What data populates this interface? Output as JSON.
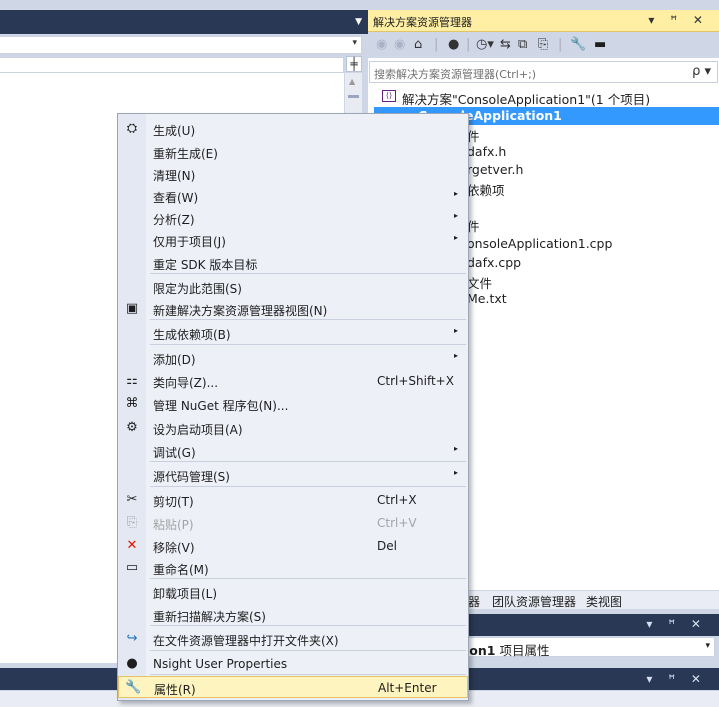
{
  "solution_explorer": {
    "title": "解决方案资源管理器",
    "window_controls": "▾ ꟸ ✕",
    "search_placeholder": "搜索解决方案资源管理器(Ctrl+;)",
    "search_icon": "ρ ▾",
    "toolbar_icons": [
      "back-icon",
      "forward-icon",
      "home-icon",
      "sync-icon",
      "history-icon",
      "collapse-icon",
      "show-all-icon",
      "properties-icon",
      "wrench-icon",
      "pin-icon"
    ],
    "tree": {
      "solution": "解决方案\"ConsoleApplication1\"(1 个项目)",
      "project": "ConsoleApplication1",
      "items": [
        "件",
        "dafx.h",
        "rgetver.h",
        "依赖项",
        "件",
        "onsoleApplication1.cpp",
        "dafx.cpp",
        "文件",
        "Me.txt"
      ]
    },
    "tabs": [
      "器",
      "团队资源管理器",
      "类视图"
    ]
  },
  "properties_panel": {
    "window_controls": "▾ ꟸ ✕",
    "combo_bold": "ion1",
    "combo_rest": " 项目属性"
  },
  "bottom_panel": {
    "window_controls": "▾ ꟸ ✕"
  },
  "context_menu": {
    "items": [
      {
        "label": "生成(U)",
        "icon": "build-icon",
        "glyph": "⛭"
      },
      {
        "label": "重新生成(E)"
      },
      {
        "label": "清理(N)"
      },
      {
        "label": "查看(W)",
        "submenu": "▸"
      },
      {
        "label": "分析(Z)",
        "submenu": "▸"
      },
      {
        "label": "仅用于项目(J)",
        "submenu": "▸"
      },
      {
        "label": "重定 SDK 版本目标"
      },
      {
        "label": "限定为此范围(S)"
      },
      {
        "label": "新建解决方案资源管理器视图(N)",
        "icon": "new-view-icon",
        "glyph": "▣"
      },
      {
        "label": "生成依赖项(B)",
        "submenu": "▸"
      },
      {
        "label": "添加(D)",
        "submenu": "▸"
      },
      {
        "label": "类向导(Z)...",
        "shortcut": "Ctrl+Shift+X",
        "icon": "class-wizard-icon",
        "glyph": "⚏"
      },
      {
        "label": "管理 NuGet 程序包(N)...",
        "icon": "nuget-icon",
        "glyph": "⌘"
      },
      {
        "label": "设为启动项目(A)",
        "icon": "gear-icon",
        "glyph": "⚙"
      },
      {
        "label": "调试(G)",
        "submenu": "▸"
      },
      {
        "label": "源代码管理(S)",
        "submenu": "▸"
      },
      {
        "label": "剪切(T)",
        "shortcut": "Ctrl+X",
        "icon": "cut-icon",
        "glyph": "✂"
      },
      {
        "label": "粘贴(P)",
        "shortcut": "Ctrl+V",
        "icon": "paste-icon",
        "glyph": "⎘",
        "disabled": true
      },
      {
        "label": "移除(V)",
        "shortcut": "Del",
        "icon": "remove-icon",
        "glyph": "✕",
        "color": "#e51400"
      },
      {
        "label": "重命名(M)",
        "icon": "rename-icon",
        "glyph": "▭"
      },
      {
        "label": "卸载项目(L)"
      },
      {
        "label": "重新扫描解决方案(S)"
      },
      {
        "label": "在文件资源管理器中打开文件夹(X)",
        "icon": "open-folder-icon",
        "glyph": "↪",
        "color": "#1e73be"
      },
      {
        "label": "Nsight User Properties",
        "icon": "nsight-icon",
        "glyph": "●"
      },
      {
        "label": "属性(R)",
        "shortcut": "Alt+Enter",
        "icon": "wrench-icon",
        "glyph": "🔧"
      }
    ]
  }
}
